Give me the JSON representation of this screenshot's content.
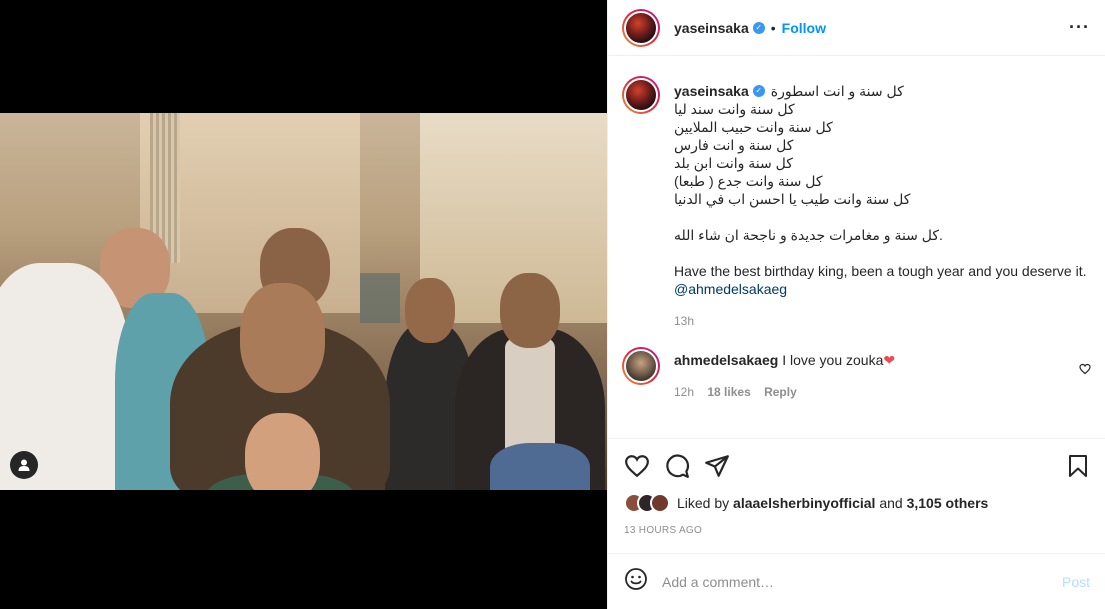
{
  "post": {
    "username": "yaseinsaka",
    "verified_icon": "verified-badge-icon",
    "dot": "•",
    "follow_label": "Follow",
    "more_icon": "more-options-icon",
    "more_glyph": "···"
  },
  "caption": {
    "username": "yaseinsaka",
    "lines": [
      "كل سنة و انت اسطورة",
      "كل سنة وانت سند ليا",
      "كل سنة وانت حبيب الملايين",
      "كل سنة و انت فارس",
      "كل سنة وانت ابن بلد",
      "كل سنة وانت جدع ( طبعا)",
      "كل سنة وانت طيب يا احسن اب في الدنيا"
    ],
    "line_arabic_2": ".كل سنة و مغامرات جديدة و ناجحة ان شاء الله",
    "line_english": "Have the best birthday king, been a tough year and you deserve it.",
    "mention": "@ahmedelsakaeg",
    "time": "13h"
  },
  "comment": {
    "username": "ahmedelsakaeg",
    "text": "I love you zouka",
    "emoji": "❤",
    "time": "12h",
    "likes": "18 likes",
    "reply_label": "Reply"
  },
  "likes": {
    "prefix": "Liked by",
    "user": "alaaelsherbinyofficial",
    "and": "and",
    "others": "3,105 others"
  },
  "timestamp": "13 HOURS AGO",
  "add_comment": {
    "placeholder": "Add a comment…",
    "post_label": "Post"
  },
  "colors": {
    "accent": "#0095f6",
    "verified": "#3897f0",
    "like_red": "#ed4956"
  }
}
